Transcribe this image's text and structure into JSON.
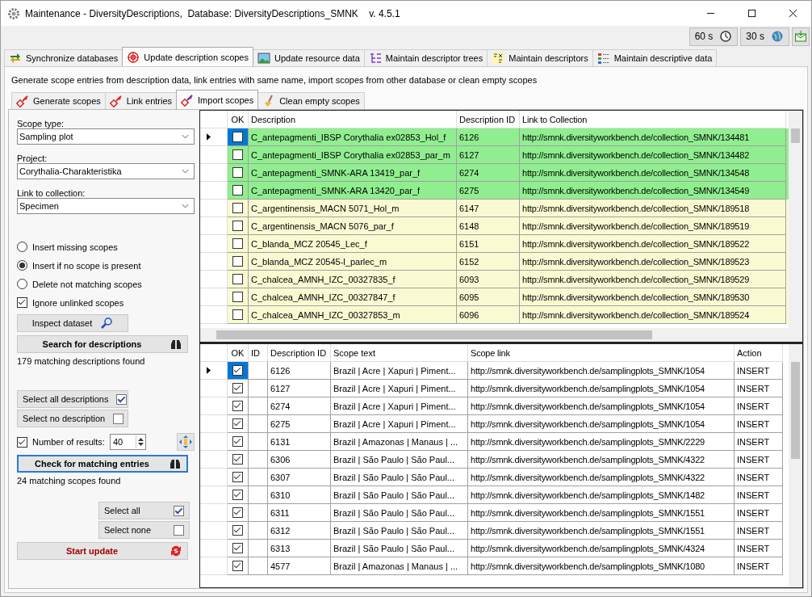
{
  "window": {
    "title": "Maintenance - DiversityDescriptions,  Database: DiversityDescriptions_SMNK    v. 4.5.1"
  },
  "toolbar": {
    "buttons": [
      {
        "label": "60 s",
        "kind": "clock"
      },
      {
        "label": "30 s",
        "kind": "globe"
      }
    ]
  },
  "tabs": [
    {
      "label": "Synchronize databases",
      "selected": false
    },
    {
      "label": "Update description scopes",
      "selected": true
    },
    {
      "label": "Update resource data",
      "selected": false
    },
    {
      "label": "Maintain descriptor trees",
      "selected": false
    },
    {
      "label": "Maintain descriptors",
      "selected": false
    },
    {
      "label": "Maintain descriptive data",
      "selected": false
    }
  ],
  "description": "Generate scope entries from description data, link entries with same name, import scopes from other database or clean empty scopes",
  "subtabs": [
    {
      "label": "Generate scopes",
      "selected": false
    },
    {
      "label": "Link entries",
      "selected": false
    },
    {
      "label": "Import scopes",
      "selected": true
    },
    {
      "label": "Clean empty scopes",
      "selected": false
    }
  ],
  "form": {
    "fields": [
      {
        "label": "Scope type:",
        "value": "Sampling plot"
      },
      {
        "label": "Project:",
        "value": "Corythalia-Charakteristika"
      },
      {
        "label": "Link to collection:",
        "value": "Specimen"
      }
    ],
    "options": [
      {
        "label": "Insert missing scopes",
        "selected": false
      },
      {
        "label": "Insert if no scope is present",
        "selected": true
      },
      {
        "label": "Delete not matching scopes",
        "selected": false
      }
    ],
    "ignore_unlinked": {
      "label": "Ignore unlinked scopes",
      "checked": true
    },
    "inspect_button": "Inspect dataset",
    "search_button": "Search for descriptions",
    "search_result": "179 matching descriptions found",
    "select_all_descriptions": {
      "label": "Select all descriptions",
      "checked": true
    },
    "select_no_description": {
      "label": "Select no description",
      "checked": false
    },
    "number_of_results": {
      "label": "Number of results:",
      "checked": true,
      "value": "40"
    },
    "check_button": "Check for matching entries",
    "check_result": "24 matching scopes found",
    "select_all": {
      "label": "Select all",
      "checked": true
    },
    "select_none": {
      "label": "Select none",
      "checked": false
    },
    "start_button": "Start update"
  },
  "descriptions_table": {
    "columns": [
      "OK",
      "Description",
      "Description ID",
      "Link to Collection"
    ],
    "rows": [
      {
        "selected": true,
        "checked": false,
        "color": "#90ee90",
        "description": "C_antepagmenti_IBSP Corythalia ex02853_Hol_f",
        "id": "6126",
        "link": "http://smnk.diversityworkbench.de/collection_SMNK/134481"
      },
      {
        "selected": false,
        "checked": false,
        "color": "#90ee90",
        "description": "C_antepagmenti_IBSP Corythalia ex02853_par_m",
        "id": "6127",
        "link": "http://smnk.diversityworkbench.de/collection_SMNK/134482"
      },
      {
        "selected": false,
        "checked": false,
        "color": "#90ee90",
        "description": "C_antepagmenti_SMNK-ARA 13419_par_f",
        "id": "6274",
        "link": "http://smnk.diversityworkbench.de/collection_SMNK/134548"
      },
      {
        "selected": false,
        "checked": false,
        "color": "#90ee90",
        "description": "C_antepagmenti_SMNK-ARA 13420_par_f",
        "id": "6275",
        "link": "http://smnk.diversityworkbench.de/collection_SMNK/134549"
      },
      {
        "selected": false,
        "checked": false,
        "color": "#fafad2",
        "description": "C_argentinensis_MACN 5071_Hol_m",
        "id": "6147",
        "link": "http://smnk.diversityworkbench.de/collection_SMNK/189518"
      },
      {
        "selected": false,
        "checked": false,
        "color": "#fafad2",
        "description": "C_argentinensis_MACN 5076_par_f",
        "id": "6148",
        "link": "http://smnk.diversityworkbench.de/collection_SMNK/189519"
      },
      {
        "selected": false,
        "checked": false,
        "color": "#fafad2",
        "description": "C_blanda_MCZ 20545_Lec_f",
        "id": "6151",
        "link": "http://smnk.diversityworkbench.de/collection_SMNK/189522"
      },
      {
        "selected": false,
        "checked": false,
        "color": "#fafad2",
        "description": "C_blanda_MCZ 20545-l_parlec_m",
        "id": "6152",
        "link": "http://smnk.diversityworkbench.de/collection_SMNK/189523"
      },
      {
        "selected": false,
        "checked": false,
        "color": "#fafad2",
        "description": "C_chalcea_AMNH_IZC_00327835_f",
        "id": "6093",
        "link": "http://smnk.diversityworkbench.de/collection_SMNK/189529"
      },
      {
        "selected": false,
        "checked": false,
        "color": "#fafad2",
        "description": "C_chalcea_AMNH_IZC_00327847_f",
        "id": "6095",
        "link": "http://smnk.diversityworkbench.de/collection_SMNK/189530"
      },
      {
        "selected": false,
        "checked": false,
        "color": "#fafad2",
        "description": "C_chalcea_AMNH_IZC_00327853_m",
        "id": "6096",
        "link": "http://smnk.diversityworkbench.de/collection_SMNK/189524"
      }
    ]
  },
  "scopes_table": {
    "columns": [
      "OK",
      "ID",
      "Description ID",
      "Scope text",
      "Scope link",
      "Action"
    ],
    "rows": [
      {
        "selected": true,
        "checked": true,
        "description_id": "6126",
        "scope_text": "Brazil | Acre | Xapuri | Piment...",
        "scope_link": "http://smnk.diversityworkbench.de/samplingplots_SMNK/1054",
        "action": "INSERT"
      },
      {
        "selected": false,
        "checked": true,
        "description_id": "6127",
        "scope_text": "Brazil | Acre | Xapuri | Piment...",
        "scope_link": "http://smnk.diversityworkbench.de/samplingplots_SMNK/1054",
        "action": "INSERT"
      },
      {
        "selected": false,
        "checked": true,
        "description_id": "6274",
        "scope_text": "Brazil | Acre | Xapuri | Piment...",
        "scope_link": "http://smnk.diversityworkbench.de/samplingplots_SMNK/1054",
        "action": "INSERT"
      },
      {
        "selected": false,
        "checked": true,
        "description_id": "6275",
        "scope_text": "Brazil | Acre | Xapuri | Piment...",
        "scope_link": "http://smnk.diversityworkbench.de/samplingplots_SMNK/1054",
        "action": "INSERT"
      },
      {
        "selected": false,
        "checked": true,
        "description_id": "6131",
        "scope_text": "Brazil | Amazonas | Manaus | ...",
        "scope_link": "http://smnk.diversityworkbench.de/samplingplots_SMNK/2229",
        "action": "INSERT"
      },
      {
        "selected": false,
        "checked": true,
        "description_id": "6306",
        "scope_text": "Brazil | São Paulo | São Paul...",
        "scope_link": "http://smnk.diversityworkbench.de/samplingplots_SMNK/4322",
        "action": "INSERT"
      },
      {
        "selected": false,
        "checked": true,
        "description_id": "6307",
        "scope_text": "Brazil | São Paulo | São Paul...",
        "scope_link": "http://smnk.diversityworkbench.de/samplingplots_SMNK/4322",
        "action": "INSERT"
      },
      {
        "selected": false,
        "checked": true,
        "description_id": "6310",
        "scope_text": "Brazil | São Paulo | São Paul...",
        "scope_link": "http://smnk.diversityworkbench.de/samplingplots_SMNK/1482",
        "action": "INSERT"
      },
      {
        "selected": false,
        "checked": true,
        "description_id": "6311",
        "scope_text": "Brazil | São Paulo | São Paul...",
        "scope_link": "http://smnk.diversityworkbench.de/samplingplots_SMNK/1551",
        "action": "INSERT"
      },
      {
        "selected": false,
        "checked": true,
        "description_id": "6312",
        "scope_text": "Brazil | São Paulo | São Paul...",
        "scope_link": "http://smnk.diversityworkbench.de/samplingplots_SMNK/1551",
        "action": "INSERT"
      },
      {
        "selected": false,
        "checked": true,
        "description_id": "6313",
        "scope_text": "Brazil | São Paulo | São Paul...",
        "scope_link": "http://smnk.diversityworkbench.de/samplingplots_SMNK/4324",
        "action": "INSERT"
      },
      {
        "selected": false,
        "checked": true,
        "description_id": "4577",
        "scope_text": "Brazil | Amazonas | Manaus | ...",
        "scope_link": "http://smnk.diversityworkbench.de/samplingplots_SMNK/1080",
        "action": "INSERT"
      }
    ]
  }
}
